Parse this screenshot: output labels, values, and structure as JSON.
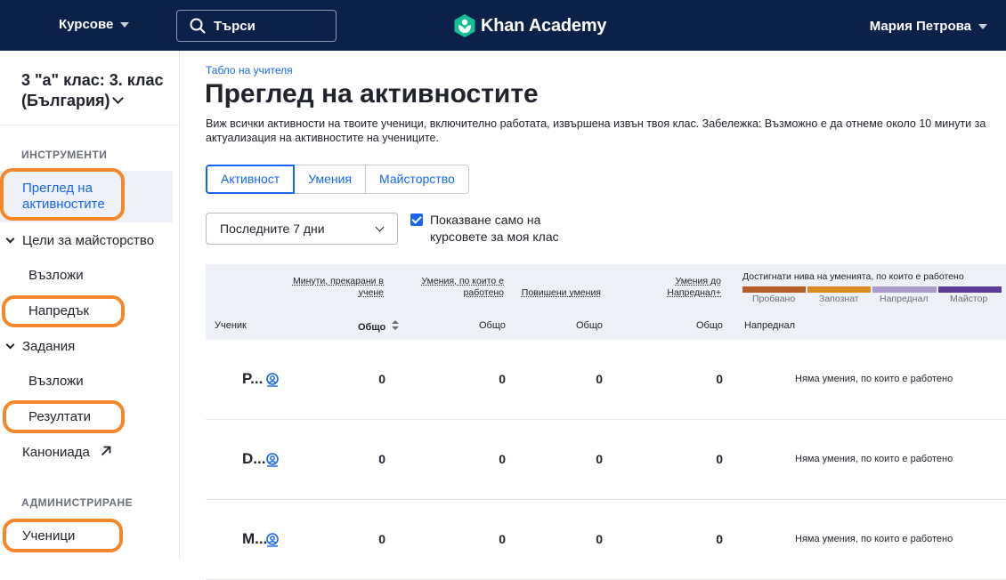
{
  "topnav": {
    "courses_label": "Курсове",
    "search_label": "Търси",
    "logo_text": "Khan Academy",
    "user_name": "Мария Петрова"
  },
  "sidebar": {
    "class_title": "3 \"а\" клас: 3. клас (България)",
    "section_tools": "ИНСТРУМЕНТИ",
    "activity_overview": "Преглед на активностите",
    "mastery_goals": "Цели за майсторство",
    "mastery_assign": "Възложи",
    "progress": "Напредък",
    "assignments": "Задания",
    "assignments_assign": "Възложи",
    "results": "Резултати",
    "kanoniada": "Канониада",
    "section_admin": "АДМИНИСТРИРАНЕ",
    "students": "Ученици"
  },
  "main": {
    "breadcrumb": "Табло на учителя",
    "title": "Преглед на активностите",
    "description": "Виж всички активности на твоите ученици, включително работата, извършена извън твоя клас. Забележка: Възможно е да отнеме около 10 минути за актуализация на активностите на учениците.",
    "tabs": [
      "Активност",
      "Умения",
      "Майсторство"
    ],
    "period_select": "Последните 7 дни",
    "checkbox_label": "Показване само на курсовете за моя клас"
  },
  "table": {
    "head": {
      "minutes": "Минути, прекарани в учене",
      "skills_worked": "Умения, по които е работено",
      "skills_up": "Повишени умения",
      "skills_to_advanced": "Умения до Напреднал+",
      "levels_reached": "Достигнати нива на уменията, по които е работено",
      "student": "Ученик",
      "total1": "Общо",
      "total2": "Общо",
      "total3": "Общо",
      "total4": "Общо",
      "advanced": "Напреднал"
    },
    "levels": [
      {
        "label": "Пробвано",
        "color": "#b85c28"
      },
      {
        "label": "Запознат",
        "color": "#dd8a22"
      },
      {
        "label": "Напреднал",
        "color": "#a99bcc"
      },
      {
        "label": "Майстор",
        "color": "#5c3a9a"
      }
    ],
    "rows": [
      {
        "name": "P...",
        "minutes": "0",
        "worked": "0",
        "up": "0",
        "to_adv": "0",
        "levels": "Няма умения, по които е работено"
      },
      {
        "name": "D...",
        "minutes": "0",
        "worked": "0",
        "up": "0",
        "to_adv": "0",
        "levels": "Няма умения, по които е работено"
      },
      {
        "name": "M...",
        "minutes": "0",
        "worked": "0",
        "up": "0",
        "to_adv": "0",
        "levels": "Няма умения, по които е работено"
      }
    ]
  },
  "colors": {
    "nav_bg": "#0b2149",
    "link_blue": "#1865f2",
    "highlight_orange": "#f5862a",
    "logo_green": "#14bf96"
  }
}
